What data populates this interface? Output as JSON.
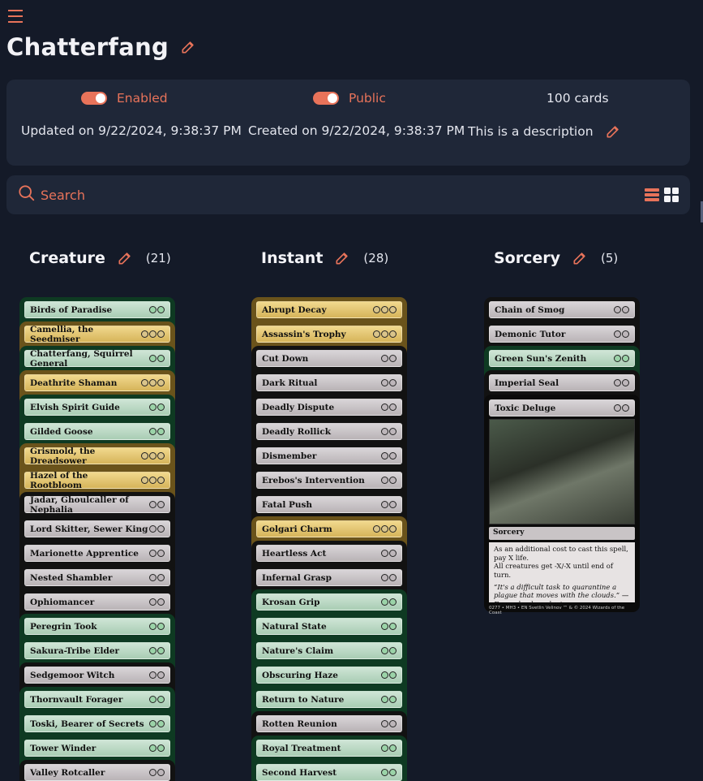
{
  "deck": {
    "title": "Chatterfang"
  },
  "info": {
    "enabled_label": "Enabled",
    "public_label": "Public",
    "card_count": "100 cards",
    "updated": "Updated on 9/22/2024, 9:38:37 PM",
    "created": "Created on 9/22/2024, 9:38:37 PM",
    "description": "This is a description"
  },
  "search": {
    "placeholder": "Search"
  },
  "colors": {
    "accent": "#e8735a",
    "background": "#141a28",
    "panel": "#1f2738"
  },
  "columns": [
    {
      "title": "Creature",
      "count": "(21)"
    },
    {
      "title": "Instant",
      "count": "(28)"
    },
    {
      "title": "Sorcery",
      "count": "(5)"
    }
  ],
  "creature_cards": [
    {
      "name": "Birds of Paradise",
      "style": "green"
    },
    {
      "name": "Camellia, the Seedmiser",
      "style": "gold"
    },
    {
      "name": "Chatterfang, Squirrel General",
      "style": "green"
    },
    {
      "name": "Deathrite Shaman",
      "style": "gold"
    },
    {
      "name": "Elvish Spirit Guide",
      "style": "green"
    },
    {
      "name": "Gilded Goose",
      "style": "green"
    },
    {
      "name": "Grismold, the Dreadsower",
      "style": "gold"
    },
    {
      "name": "Hazel of the Rootbloom",
      "style": "gold"
    },
    {
      "name": "Jadar, Ghoulcaller of Nephalia",
      "style": "black"
    },
    {
      "name": "Lord Skitter, Sewer King",
      "style": "black"
    },
    {
      "name": "Marionette Apprentice",
      "style": "black"
    },
    {
      "name": "Nested Shambler",
      "style": "black"
    },
    {
      "name": "Ophiomancer",
      "style": "black"
    },
    {
      "name": "Peregrin Took",
      "style": "green"
    },
    {
      "name": "Sakura-Tribe Elder",
      "style": "green"
    },
    {
      "name": "Sedgemoor Witch",
      "style": "black"
    },
    {
      "name": "Thornvault Forager",
      "style": "green"
    },
    {
      "name": "Toski, Bearer of Secrets",
      "style": "green"
    },
    {
      "name": "Tower Winder",
      "style": "green"
    },
    {
      "name": "Valley Rotcaller",
      "style": "black"
    }
  ],
  "instant_cards": [
    {
      "name": "Abrupt Decay",
      "style": "gold"
    },
    {
      "name": "Assassin's Trophy",
      "style": "gold"
    },
    {
      "name": "Cut Down",
      "style": "black"
    },
    {
      "name": "Dark Ritual",
      "style": "black"
    },
    {
      "name": "Deadly Dispute",
      "style": "black"
    },
    {
      "name": "Deadly Rollick",
      "style": "black"
    },
    {
      "name": "Dismember",
      "style": "black"
    },
    {
      "name": "Erebos's Intervention",
      "style": "black"
    },
    {
      "name": "Fatal Push",
      "style": "black"
    },
    {
      "name": "Golgari Charm",
      "style": "gold"
    },
    {
      "name": "Heartless Act",
      "style": "black"
    },
    {
      "name": "Infernal Grasp",
      "style": "black"
    },
    {
      "name": "Krosan Grip",
      "style": "green"
    },
    {
      "name": "Natural State",
      "style": "green"
    },
    {
      "name": "Nature's Claim",
      "style": "green"
    },
    {
      "name": "Obscuring Haze",
      "style": "green"
    },
    {
      "name": "Return to Nature",
      "style": "green"
    },
    {
      "name": "Rotten Reunion",
      "style": "black"
    },
    {
      "name": "Royal Treatment",
      "style": "green"
    },
    {
      "name": "Second Harvest",
      "style": "green"
    }
  ],
  "sorcery_cards": [
    {
      "name": "Chain of Smog",
      "style": "black"
    },
    {
      "name": "Demonic Tutor",
      "style": "black"
    },
    {
      "name": "Green Sun's Zenith",
      "style": "green"
    },
    {
      "name": "Imperial Seal",
      "style": "black"
    }
  ],
  "featured_card": {
    "name": "Toxic Deluge",
    "type_line": "Sorcery",
    "rules_1": "As an additional cost to cast this spell, pay X life.",
    "rules_2": "All creatures get -X/-X until end of turn.",
    "flavor": "“It's a difficult task to quarantine a plague that moves with the clouds.” —Esara, healer adept",
    "footer": "0277 • MH3 • EN  Svetlin Velinov   ™ & © 2024 Wizards of the Coast"
  }
}
